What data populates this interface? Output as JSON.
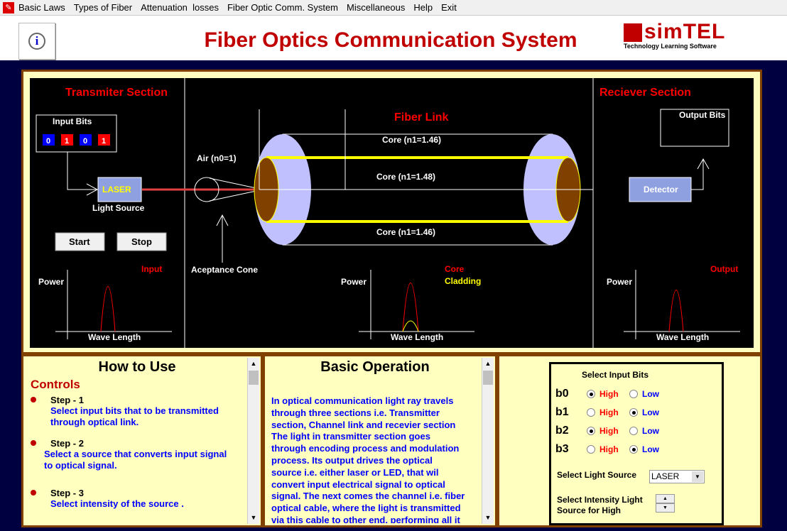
{
  "menu": [
    "Basic Laws",
    "Types of Fiber",
    "Attenuation  losses",
    "Fiber Optic Comm. System",
    "Miscellaneous",
    "Help",
    "Exit"
  ],
  "header": {
    "title": "Fiber Optics Communication System",
    "logo_text": "simTEL",
    "logo_tagline": "Technology Learning Software",
    "info_icon": "info-bubble-icon"
  },
  "diagram": {
    "transmitter_title": "Transmiter Section",
    "input_bits_label": "Input Bits",
    "input_bits": [
      "0",
      "1",
      "0",
      "1"
    ],
    "laser_label": "LASER",
    "light_source_label": "Light Source",
    "start_label": "Start",
    "stop_label": "Stop",
    "air_label": "Air (n0=1)",
    "acceptance_label": "Aceptance Cone",
    "fiber_title": "Fiber Link",
    "core_top": "Core (n1=1.46)",
    "core_mid": "Core (n1=1.48)",
    "core_bot": "Core (n1=1.46)",
    "receiver_title": "Reciever Section",
    "output_bits_label": "Output Bits",
    "detector_label": "Detector",
    "power_label": "Power",
    "wavelength_label": "Wave Length",
    "input_label": "Input",
    "core_legend": "Core",
    "cladding_legend": "Cladding",
    "output_label": "Output",
    "colors": {
      "bit_high": "#ff0000",
      "bit_low": "#0000ff",
      "core": "#ffff00",
      "cladding": "#c0c0ff",
      "brown": "#804000"
    }
  },
  "how_to_use": {
    "title": "How to Use",
    "controls": "Controls",
    "steps": [
      {
        "head": "Step - 1",
        "text": "Select input bits that to be transmitted through optical link."
      },
      {
        "head": "Step - 2",
        "text": "Select a source that converts input signal to optical signal."
      },
      {
        "head": "Step - 3",
        "text": "Select intensity of the source ."
      }
    ]
  },
  "basic_operation": {
    "title": "Basic Operation",
    "text": "In optical communication light ray travels\nthrough three sections i.e. Transmitter\nsection, Channel link  and recevier section\nThe light in transmitter section goes\nthrough encoding process and modulation\nprocess. Its output drives the optical\nsource i.e. either laser or LED, that wil\nconvert input electrical signal to optical\nsignal. The next comes the channel i.e. fiber\noptical cable, where the light is transmitted\nvia this cable to other end, performing all it"
  },
  "controls": {
    "title": "Select Input Bits",
    "bits": [
      {
        "label": "b0",
        "high": "High",
        "low": "Low",
        "selected": "High"
      },
      {
        "label": "b1",
        "high": "High",
        "low": "Low",
        "selected": "Low"
      },
      {
        "label": "b2",
        "high": "High",
        "low": "Low",
        "selected": "High"
      },
      {
        "label": "b3",
        "high": "High",
        "low": "Low",
        "selected": "Low"
      }
    ],
    "source_label": "Select Light Source",
    "source_value": "LASER",
    "intensity_label": "Select Intensity Light Source for High"
  }
}
